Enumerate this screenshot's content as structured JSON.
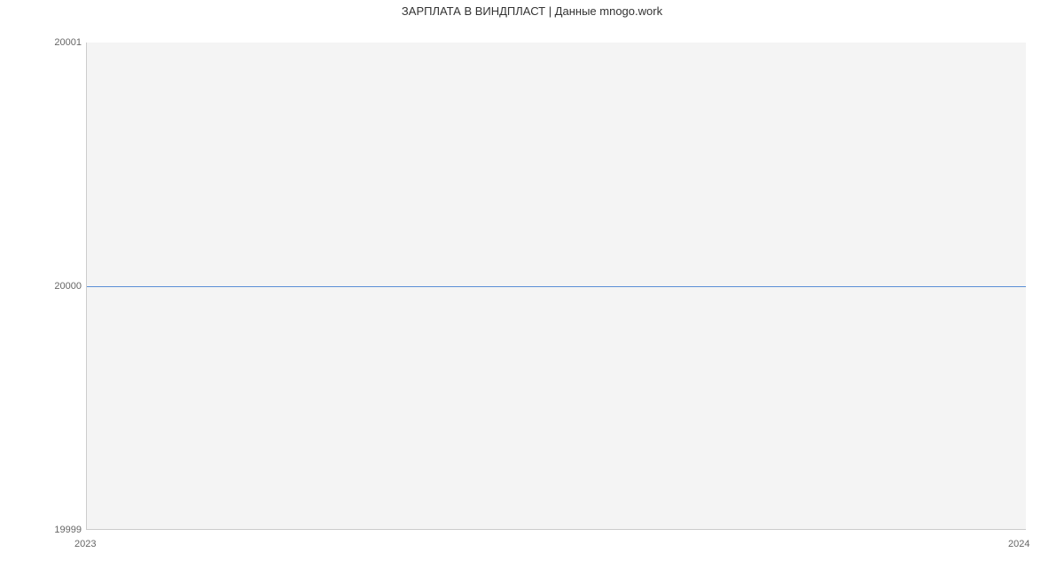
{
  "chart_data": {
    "type": "line",
    "title": "ЗАРПЛАТА В ВИНДПЛАСТ | Данные mnogo.work",
    "x": [
      "2023",
      "2024"
    ],
    "values": [
      20000,
      20000
    ],
    "y_ticks": [
      "19999",
      "20000",
      "20001"
    ],
    "x_ticks": [
      "2023",
      "2024"
    ],
    "ylim": [
      19999,
      20001
    ],
    "xlabel": "",
    "ylabel": "",
    "series_color": "#5b8fd6"
  }
}
